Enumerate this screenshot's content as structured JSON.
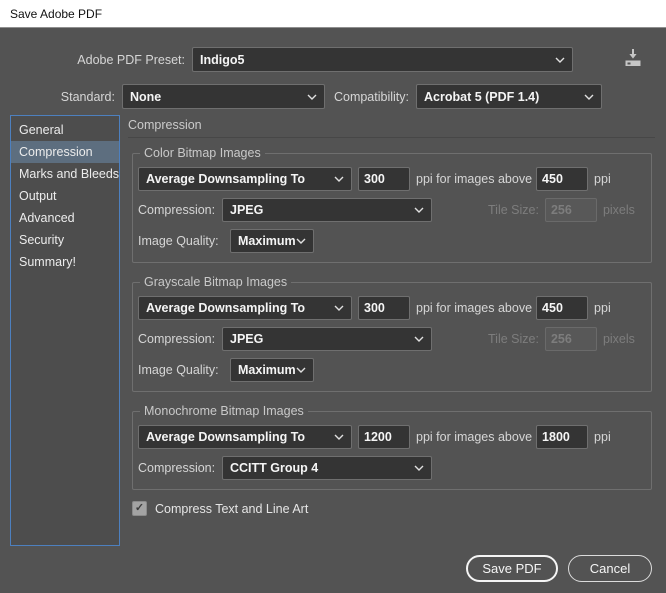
{
  "window": {
    "title": "Save Adobe PDF"
  },
  "preset": {
    "label": "Adobe PDF Preset:",
    "value": "Indigo5"
  },
  "standard": {
    "label": "Standard:",
    "value": "None"
  },
  "compatibility": {
    "label": "Compatibility:",
    "value": "Acrobat 5 (PDF 1.4)"
  },
  "sidebar": {
    "items": [
      {
        "label": "General",
        "selected": false
      },
      {
        "label": "Compression",
        "selected": true
      },
      {
        "label": "Marks and Bleeds",
        "selected": false
      },
      {
        "label": "Output",
        "selected": false
      },
      {
        "label": "Advanced",
        "selected": false
      },
      {
        "label": "Security",
        "selected": false
      },
      {
        "label": "Summary!",
        "selected": false
      }
    ]
  },
  "panel": {
    "title": "Compression",
    "groups": [
      {
        "title": "Color Bitmap Images",
        "method": "Average Downsampling To",
        "ppi": "300",
        "above_label": "ppi for images above",
        "above_value": "450",
        "ppi_suffix": "ppi",
        "compression_label": "Compression:",
        "compression_value": "JPEG",
        "tile_label": "Tile Size:",
        "tile_value": "256",
        "tile_suffix": "pixels",
        "quality_label": "Image Quality:",
        "quality_value": "Maximum"
      },
      {
        "title": "Grayscale Bitmap Images",
        "method": "Average Downsampling To",
        "ppi": "300",
        "above_label": "ppi for images above",
        "above_value": "450",
        "ppi_suffix": "ppi",
        "compression_label": "Compression:",
        "compression_value": "JPEG",
        "tile_label": "Tile Size:",
        "tile_value": "256",
        "tile_suffix": "pixels",
        "quality_label": "Image Quality:",
        "quality_value": "Maximum"
      },
      {
        "title": "Monochrome Bitmap Images",
        "method": "Average Downsampling To",
        "ppi": "1200",
        "above_label": "ppi for images above",
        "above_value": "1800",
        "ppi_suffix": "ppi",
        "compression_label": "Compression:",
        "compression_value": "CCITT Group 4"
      }
    ],
    "compress_text": {
      "label": "Compress Text and Line Art",
      "checked": true
    }
  },
  "icons": {
    "checkmark": "✓"
  },
  "footer": {
    "save": "Save PDF",
    "cancel": "Cancel"
  },
  "colors": {
    "dialog_bg": "#535353",
    "titlebar_bg": "#ffffff",
    "control_bg": "#343434",
    "control_border": "#6f6f6f",
    "selected_item_bg": "#5d6e7f",
    "sidebar_border": "#4d80bf",
    "disabled_text": "#7d7d7d",
    "button_border": "#f5f5f5"
  }
}
